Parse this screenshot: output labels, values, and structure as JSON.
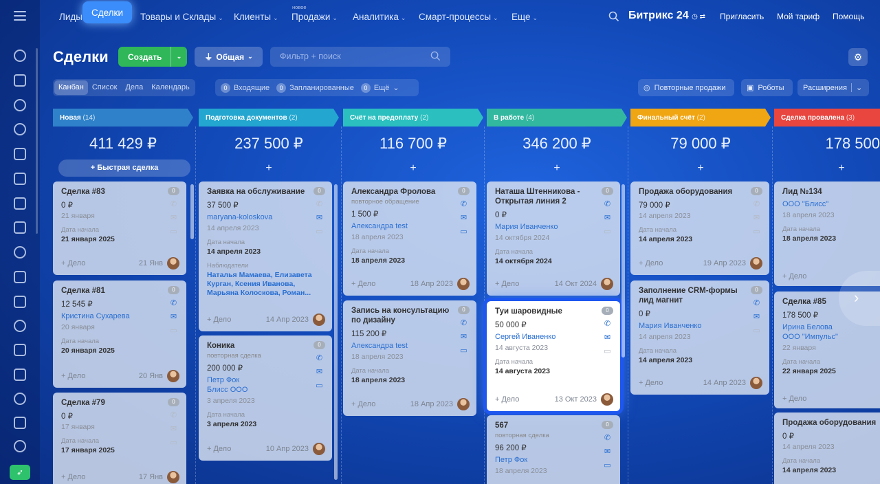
{
  "nav": {
    "items": [
      "Лиды",
      "Сделки",
      "Товары и Склады",
      "Клиенты",
      "Продажи",
      "Аналитика",
      "Смарт-процессы",
      "Еще"
    ],
    "new_badge": "новое",
    "brand": "Битрикс 24",
    "invite": "Пригласить",
    "tariff": "Мой тариф",
    "help": "Помощь"
  },
  "header": {
    "title": "Сделки",
    "create": "Создать",
    "filter_preset": "Общая",
    "search_placeholder": "Фильтр + поиск"
  },
  "views": [
    "Канбан",
    "Список",
    "Дела",
    "Календарь"
  ],
  "counters": [
    {
      "n": "0",
      "label": "Входящие"
    },
    {
      "n": "0",
      "label": "Запланированные"
    },
    {
      "n": "0",
      "label": "Ещё"
    }
  ],
  "right_buttons": {
    "repeat": "Повторные продажи",
    "robots": "Роботы",
    "ext": "Расширения"
  },
  "quick_deal": "+ Быстрая сделка",
  "date_label": "Дата начала",
  "add_activity": "+ Дело",
  "observers_label": "Наблюдатели",
  "columns": [
    {
      "name": "Новая",
      "count": "(14)",
      "sum": "411 429 ₽",
      "color": "#2f82c9"
    },
    {
      "name": "Подготовка документов",
      "count": "(2)",
      "sum": "237 500 ₽",
      "color": "#23a6cf"
    },
    {
      "name": "Счёт на предоплату",
      "count": "(2)",
      "sum": "116 700 ₽",
      "color": "#2bbfbf"
    },
    {
      "name": "В работе",
      "count": "(4)",
      "sum": "346 200 ₽",
      "color": "#33b8a0"
    },
    {
      "name": "Финальный счёт",
      "count": "(2)",
      "sum": "79 000 ₽",
      "color": "#f0a512"
    },
    {
      "name": "Сделка провалена",
      "count": "(3)",
      "sum": "178 500",
      "color": "#e8463f"
    }
  ],
  "cards": {
    "c1": {
      "title": "Сделка #83",
      "amount": "0 ₽",
      "date": "21 января",
      "start": "21 января 2025",
      "fdate": "21 Янв",
      "badge": "0"
    },
    "c2": {
      "title": "Сделка #81",
      "amount": "12 545 ₽",
      "contact": "Кристина Сухарева",
      "date": "20 января",
      "start": "20 января 2025",
      "fdate": "20 Янв",
      "badge": "0"
    },
    "c3": {
      "title": "Сделка #79",
      "amount": "0 ₽",
      "date": "17 января",
      "start": "17 января 2025",
      "fdate": "17 Янв",
      "badge": "0"
    },
    "c4": {
      "title": "Заявка на обслуживание",
      "amount": "37 500 ₽",
      "contact": "maryana-koloskova",
      "date": "14 апреля 2023",
      "start": "14 апреля 2023",
      "observers": "Наталья Мамаева, Елизавета Курган, Ксения Иванова, Марьяна Колоскова, Роман...",
      "fdate": "14 Апр 2023",
      "badge": "0"
    },
    "c5": {
      "title": "Коника",
      "sub": "повторная сделка",
      "amount": "200 000 ₽",
      "contact": "Петр Фок",
      "company": "Блисс ООО",
      "date": "3 апреля 2023",
      "start": "3 апреля 2023",
      "fdate": "10 Апр 2023",
      "badge": "0"
    },
    "c6": {
      "title": "Александра Фролова",
      "sub": "повторное обращение",
      "amount": "1 500 ₽",
      "contact": "Александра test",
      "date": "18 апреля 2023",
      "start": "18 апреля 2023",
      "fdate": "18 Апр 2023",
      "badge": "0"
    },
    "c7": {
      "title": "Запись на консультацию по дизайну",
      "amount": "115 200 ₽",
      "contact": "Александра test",
      "date": "18 апреля 2023",
      "start": "18 апреля 2023",
      "fdate": "18 Апр 2023",
      "badge": "0"
    },
    "c8": {
      "title": "Наташа Штенникова - Открытая линия 2",
      "amount": "0 ₽",
      "contact": "Мария Иванченко",
      "date": "14 октября 2024",
      "start": "14 октября 2024",
      "fdate": "14 Окт 2024",
      "badge": "0"
    },
    "c9": {
      "title": "Туи шаровидные",
      "amount": "50 000 ₽",
      "contact": "Сергей Иваненко",
      "date": "14 августа 2023",
      "start": "14 августа 2023",
      "fdate": "13 Окт 2023",
      "badge": "0"
    },
    "c10": {
      "title": "567",
      "sub": "повторная сделка",
      "amount": "96 200 ₽",
      "contact": "Петр Фок",
      "date": "18 апреля 2023",
      "badge": "0"
    },
    "c11": {
      "title": "Продажа оборудования",
      "amount": "79 000 ₽",
      "date": "14 апреля 2023",
      "start": "14 апреля 2023",
      "fdate": "19 Апр 2023",
      "badge": "0"
    },
    "c12": {
      "title": "Заполнение CRM-формы лид магнит",
      "amount": "0 ₽",
      "contact": "Мария Иванченко",
      "date": "14 апреля 2023",
      "start": "14 апреля 2023",
      "fdate": "14 Апр 2023",
      "badge": "0"
    },
    "c13": {
      "title": "Лид №134",
      "contact": "ООО \"Блисс\"",
      "date": "18 апреля 2023",
      "start": "18 апреля 2023"
    },
    "c14": {
      "title": "Сделка #85",
      "amount": "178 500 ₽",
      "contact": "Ирина Белова",
      "company": "ООО \"Импульс\"",
      "date": "22 января",
      "start": "22 января 2025"
    },
    "c15": {
      "title": "Продажа оборудования",
      "amount": "0 ₽",
      "date": "14 апреля 2023",
      "start": "14 апреля 2023"
    }
  }
}
